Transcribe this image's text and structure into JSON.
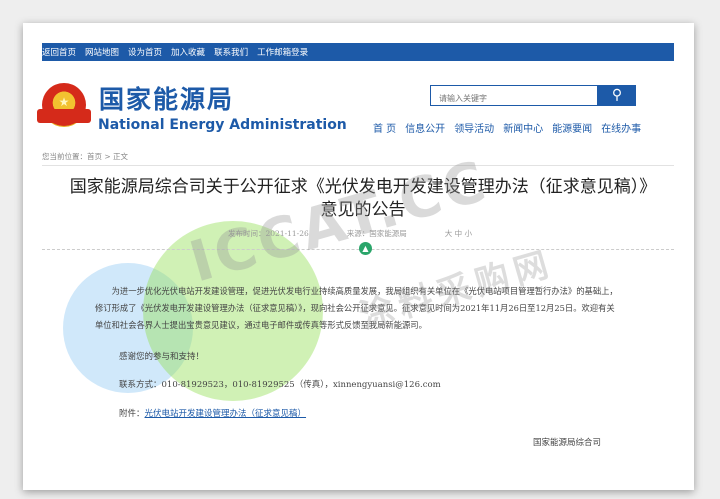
{
  "topbar": {
    "links": [
      "返回首页",
      "网站地图",
      "设为首页",
      "加入收藏",
      "联系我们",
      "工作邮箱登录"
    ]
  },
  "header": {
    "org_cn": "国家能源局",
    "org_en": "National Energy Administration",
    "emblem_icon": "national-emblem-icon"
  },
  "search": {
    "placeholder": "请输入关键字",
    "button_icon": "search-icon"
  },
  "nav": {
    "items": [
      "首 页",
      "信息公开",
      "领导活动",
      "新闻中心",
      "能源要闻",
      "在线办事"
    ]
  },
  "breadcrumb": {
    "text": "您当前位置：首页 > 正文"
  },
  "article": {
    "title": "国家能源局综合司关于公开征求《光伏发电开发建设管理办法（征求意见稿）》意见的公告",
    "date": "发布时间：2021-11-26",
    "source": "来源：国家能源局",
    "font_size": "大  中  小",
    "body": "为进一步优化光伏电站开发建设管理，促进光伏发电行业持续高质量发展，我局组织有关单位在《光伏电站项目管理暂行办法》的基础上，修订形成了《光伏发电开发建设管理办法（征求意见稿）》，现向社会公开征求意见。征求意见时间为2021年11月26日至12月25日。欢迎有关单位和社会各界人士提出宝贵意见建议，通过电子邮件或传真等形式反馈至我局新能源司。",
    "thanks": "感谢您的参与和支持！",
    "contact": "联系方式：010-81929523，010-81929525（传真），xinnengyuansi@126.com",
    "attachment_label": "附件：",
    "attachment_link": "光伏电站开发建设管理办法（征求意见稿）",
    "signature": "国家能源局综合司"
  },
  "watermark": {
    "text": "ICCAT.CC",
    "subtext": "涂料采购网"
  },
  "colors": {
    "brand_blue": "#1d5aa8",
    "badge_green": "#2aa56a"
  }
}
